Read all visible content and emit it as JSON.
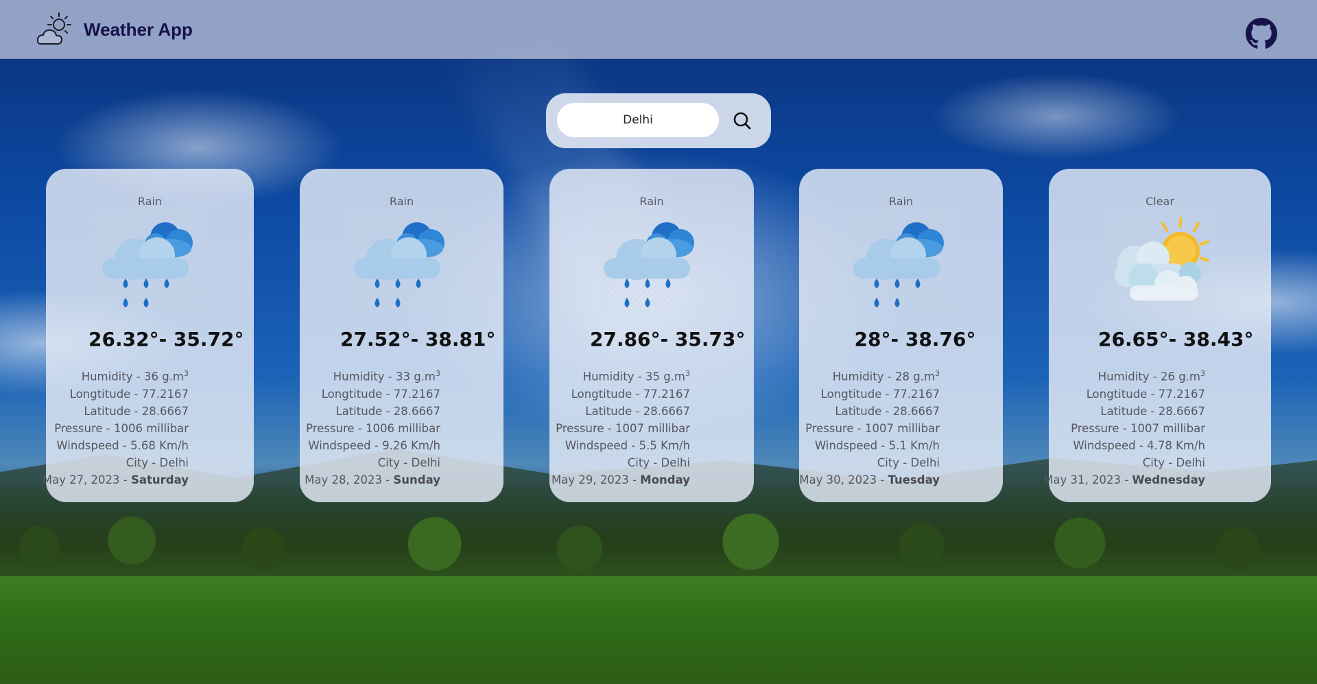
{
  "header": {
    "title": "Weather App",
    "logo_icon": "sun-behind-cloud-icon",
    "github_icon": "github-icon"
  },
  "search": {
    "value": "Delhi",
    "placeholder": "",
    "button_icon": "search-icon"
  },
  "labels": {
    "humidity": "Humidity - ",
    "humidity_unit": " g.m",
    "humidity_sup": "3",
    "longitude": "Longtitude - ",
    "latitude": "Latitude - ",
    "pressure": "Pressure - ",
    "pressure_unit": " millibar",
    "windspeed": "Windspeed - ",
    "windspeed_unit": " Km/h",
    "city": "City - ",
    "date_sep": " - "
  },
  "cards": [
    {
      "condition": "Rain",
      "icon": "rain-cloud-icon",
      "temp": "26.32°- 35.72°",
      "humidity": "36",
      "longitude": "77.2167",
      "latitude": "28.6667",
      "pressure": "1006",
      "windspeed": "5.68",
      "city": "Delhi",
      "date": "May 27, 2023",
      "day": "Saturday"
    },
    {
      "condition": "Rain",
      "icon": "rain-cloud-icon",
      "temp": "27.52°- 38.81°",
      "humidity": "33",
      "longitude": "77.2167",
      "latitude": "28.6667",
      "pressure": "1006",
      "windspeed": "9.26",
      "city": "Delhi",
      "date": "May 28, 2023",
      "day": "Sunday"
    },
    {
      "condition": "Rain",
      "icon": "rain-cloud-icon",
      "temp": "27.86°- 35.73°",
      "humidity": "35",
      "longitude": "77.2167",
      "latitude": "28.6667",
      "pressure": "1007",
      "windspeed": "5.5",
      "city": "Delhi",
      "date": "May 29, 2023",
      "day": "Monday"
    },
    {
      "condition": "Rain",
      "icon": "rain-cloud-icon",
      "temp": "28°- 38.76°",
      "humidity": "28",
      "longitude": "77.2167",
      "latitude": "28.6667",
      "pressure": "1007",
      "windspeed": "5.1",
      "city": "Delhi",
      "date": "May 30, 2023",
      "day": "Tuesday"
    },
    {
      "condition": "Clear",
      "icon": "sun-behind-clouds-icon",
      "temp": "26.65°- 38.43°",
      "humidity": "26",
      "longitude": "77.2167",
      "latitude": "28.6667",
      "pressure": "1007",
      "windspeed": "4.78",
      "city": "Delhi",
      "date": "May 31, 2023",
      "day": "Wednesday"
    }
  ],
  "colors": {
    "header_title": "#17124a",
    "rain_cloud_front": "#a7cbe8",
    "rain_cloud_back": "#2f7fcf",
    "rain_drop": "#1d6fc2",
    "sun": "#f6b92e",
    "sun_ray": "#f4c02c"
  }
}
